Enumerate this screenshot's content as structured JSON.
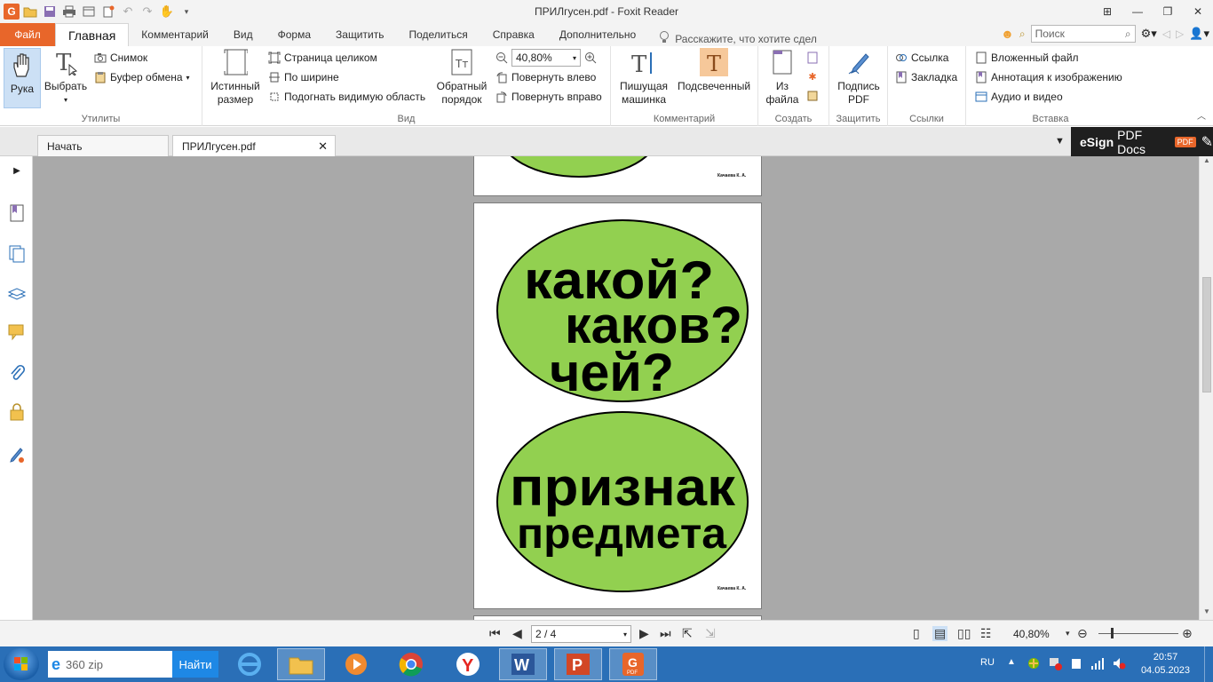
{
  "window": {
    "title": "ПРИЛгусен.pdf - Foxit Reader"
  },
  "ribbon_tabs": [
    "Файл",
    "Главная",
    "Комментарий",
    "Вид",
    "Форма",
    "Защитить",
    "Поделиться",
    "Справка",
    "Дополнительно"
  ],
  "tell_me": "Расскажите, что хотите сдел",
  "search": {
    "placeholder": "Поиск"
  },
  "ribbon": {
    "hand": "Рука",
    "select": "Выбрать",
    "snapshot": "Снимок",
    "clipboard": "Буфер обмена",
    "utilities_label": "Утилиты",
    "actual_size": [
      "Истинный",
      "размер"
    ],
    "fit_page": "Страница целиком",
    "fit_width": "По ширине",
    "fit_visible": "Подогнать видимую область",
    "reverse": [
      "Обратный",
      "порядок"
    ],
    "zoom_value": "40,80%",
    "rotate_left": "Повернуть влево",
    "rotate_right": "Повернуть вправо",
    "view_label": "Вид",
    "typewriter": [
      "Пишущая",
      "машинка"
    ],
    "highlight": "Подсвеченный",
    "comment_label": "Комментарий",
    "from_file": [
      "Из",
      "файла"
    ],
    "create_label": "Создать",
    "sign_pdf": [
      "Подпись",
      "PDF"
    ],
    "protect_label": "Защитить",
    "link": "Ссылка",
    "bookmark": "Закладка",
    "links_label": "Ссылки",
    "attached_file": "Вложенный файл",
    "image_annotation": "Аннотация к изображению",
    "audio_video": "Аудио и видео",
    "insert_label": "Вставка"
  },
  "doc_tabs": {
    "start": "Начать",
    "current": "ПРИЛгусен.pdf"
  },
  "esign": {
    "brand": "eSign",
    "rest": "PDF Docs",
    "badge": "PDF"
  },
  "page_content": {
    "line1": "какой?",
    "line2": "каков?",
    "line3": "чей?",
    "line4": "признак",
    "line5": "предмета",
    "credit": "Качаева К. А.",
    "oval_color": "#92d050"
  },
  "status": {
    "page": "2 / 4",
    "zoom": "40,80%"
  },
  "taskbar": {
    "search_text": "360 zip",
    "find": "Найти",
    "lang": "RU",
    "time": "20:57",
    "date": "04.05.2023"
  }
}
